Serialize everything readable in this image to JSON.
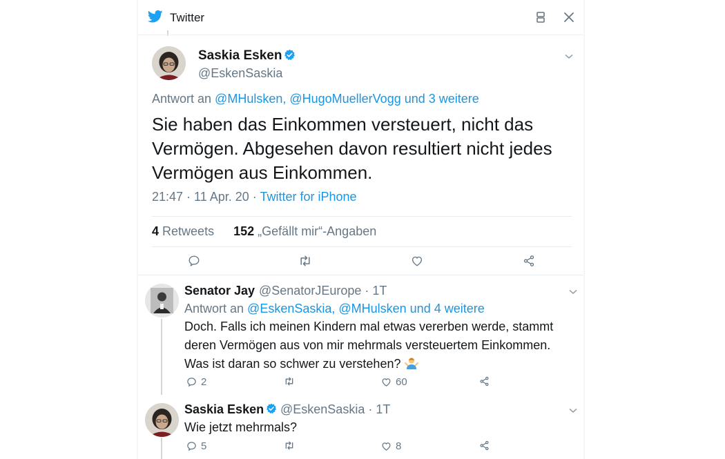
{
  "window": {
    "title": "Twitter",
    "brand_color": "#1DA1F2",
    "icons": [
      "twitter-logo-icon",
      "split-view-icon",
      "close-icon"
    ]
  },
  "main_tweet": {
    "name": "Saskia Esken",
    "handle": "@EskenSaskia",
    "reply_prefix": "Antwort an ",
    "reply_users": "@MHulsken, @HugoMuellerVogg",
    "reply_suffix": " und 3 weitere",
    "text": "Sie haben das Einkommen versteuert, nicht das Vermögen. Abgesehen davon resultiert nicht jedes Vermögen aus Einkommen.",
    "time": "21:47 · 11 Apr. 20 · ",
    "source": "Twitter for iPhone",
    "retweets_count": "4",
    "retweets_label": "Retweets",
    "likes_count": "152",
    "likes_label": "„Gefällt mir“-Angaben"
  },
  "replies": [
    {
      "name": "Senator Jay",
      "handle_time": "@SenatorJEurope · 1T",
      "reply_prefix": "Antwort an ",
      "reply_users": "@EskenSaskia, @MHulsken",
      "reply_suffix": " und 4 weitere",
      "text": "Doch. Falls ich meinen Kindern mal etwas vererben werde, stammt deren Vermögen aus von mir mehrmals versteuertem Einkommen. Was ist daran so schwer zu verstehen?",
      "emoji": "person-shrugging-emoji",
      "reply_count": "2",
      "retweet_count": "",
      "like_count": "60"
    },
    {
      "name": "Saskia Esken",
      "handle_time": "@EskenSaskia · 1T",
      "text": "Wie jetzt mehrmals?",
      "reply_count": "5",
      "retweet_count": "",
      "like_count": "8"
    }
  ],
  "colors": {
    "link": "#1B95E0",
    "secondary_text": "#657786",
    "primary_text": "#14171A",
    "verified": "#1DA1F2"
  }
}
